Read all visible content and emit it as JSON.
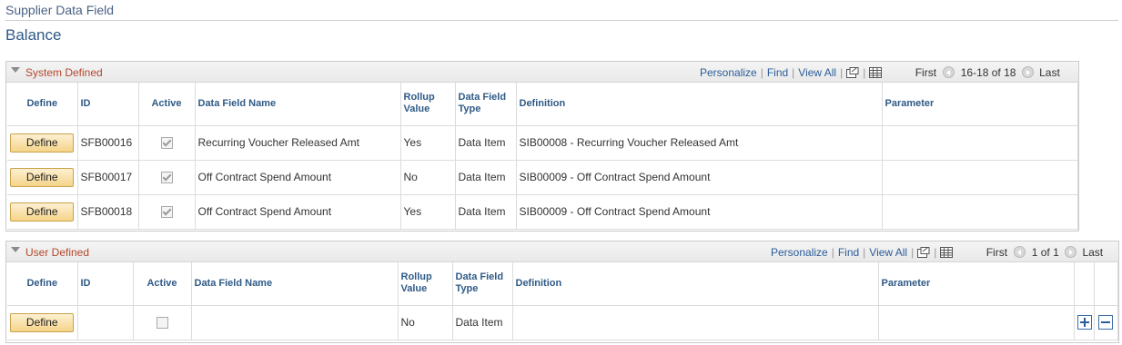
{
  "breadcrumb": "Supplier Data Field",
  "page_title": "Balance",
  "system_defined": {
    "title": "System Defined",
    "nav": {
      "personalize": "Personalize",
      "find": "Find",
      "view_all": "View All",
      "first": "First",
      "range": "16-18 of 18",
      "last": "Last"
    },
    "columns": {
      "define": "Define",
      "id": "ID",
      "active": "Active",
      "name": "Data Field Name",
      "rollup": "Rollup Value",
      "type": "Data Field Type",
      "definition": "Definition",
      "parameter": "Parameter"
    },
    "rows": [
      {
        "define": "Define",
        "id": "SFB00016",
        "active": true,
        "name": "Recurring Voucher Released Amt",
        "rollup": "Yes",
        "type": "Data Item",
        "definition": "SIB00008 - Recurring Voucher Released Amt",
        "parameter": ""
      },
      {
        "define": "Define",
        "id": "SFB00017",
        "active": true,
        "name": "Off Contract Spend Amount",
        "rollup": "No",
        "type": "Data Item",
        "definition": "SIB00009 - Off Contract Spend Amount",
        "parameter": ""
      },
      {
        "define": "Define",
        "id": "SFB00018",
        "active": true,
        "name": "Off Contract Spend Amount",
        "rollup": "Yes",
        "type": "Data Item",
        "definition": "SIB00009 - Off Contract Spend Amount",
        "parameter": ""
      }
    ]
  },
  "user_defined": {
    "title": "User Defined",
    "nav": {
      "personalize": "Personalize",
      "find": "Find",
      "view_all": "View All",
      "first": "First",
      "range": "1 of 1",
      "last": "Last"
    },
    "columns": {
      "define": "Define",
      "id": "ID",
      "active": "Active",
      "name": "Data Field Name",
      "rollup": "Rollup Value",
      "type": "Data Field Type",
      "definition": "Definition",
      "parameter": "Parameter"
    },
    "rows": [
      {
        "define": "Define",
        "id": "",
        "active": false,
        "name": "",
        "rollup": "No",
        "type": "Data Item",
        "definition": "",
        "parameter": ""
      }
    ]
  }
}
